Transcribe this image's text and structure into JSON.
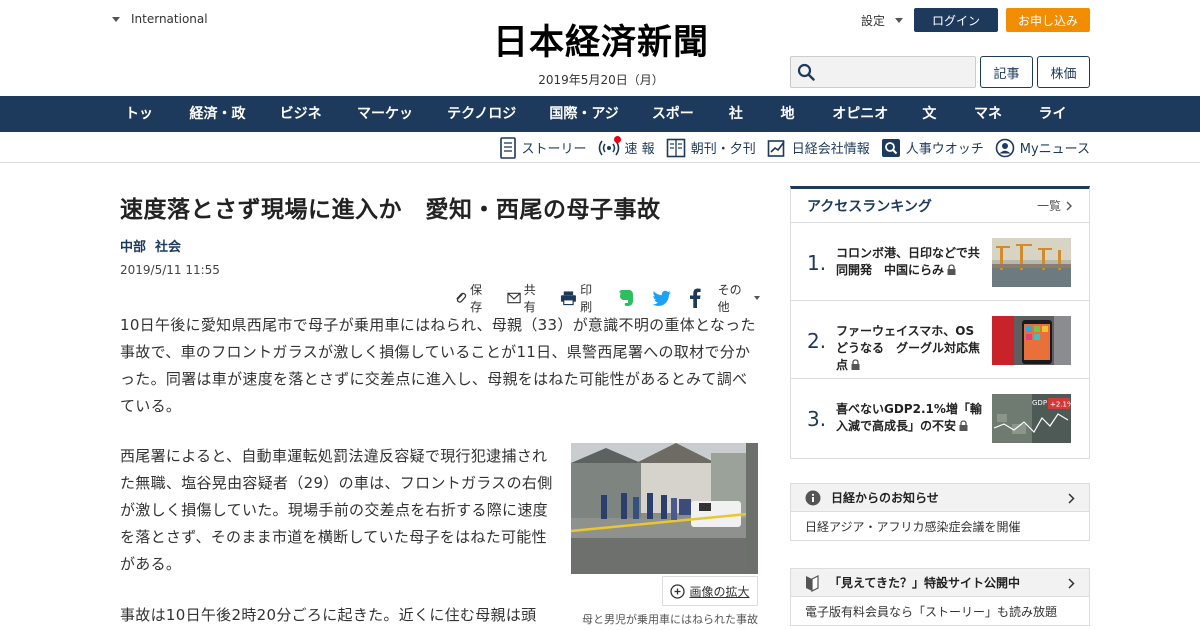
{
  "header": {
    "international_label": "International",
    "logo_text": "日本経済新聞",
    "date": "2019年5月20日（月）",
    "settings_label": "設定",
    "login_label": "ログイン",
    "apply_label": "お申し込み",
    "search_placeholder": "",
    "article_button": "記事",
    "stock_button": "株価"
  },
  "main_nav": [
    "トップ",
    "経済・政治",
    "ビジネス",
    "マーケット",
    "テクノロジー",
    "国際・アジア",
    "スポーツ",
    "社会",
    "地域",
    "オピニオン",
    "文化",
    "マネー",
    "ライフ"
  ],
  "sub_nav": {
    "story": "ストーリー",
    "breaking": "速 報",
    "paper": "朝刊・夕刊",
    "company": "日経会社情報",
    "personnel": "人事ウオッチ",
    "mynews": "Myニュース"
  },
  "article": {
    "headline": "速度落とさず現場に進入か　愛知・西尾の母子事故",
    "categories": [
      "中部",
      "社会"
    ],
    "published": "2019/5/11 11:55",
    "tools": {
      "save": "保存",
      "share": "共有",
      "print": "印刷",
      "more": "その他"
    },
    "paragraphs": [
      "10日午後に愛知県西尾市で母子が乗用車にはねられ、母親（33）が意識不明の重体となった事故で、車のフロントガラスが激しく損傷していることが11日、県警西尾署への取材で分かった。同署は車が速度を落とさずに交差点に進入し、母親をはねた可能性があるとみて調べている。",
      "西尾署によると、自動車運転処罰法違反容疑で現行犯逮捕された無職、塩谷晃由容疑者（29）の車は、フロントガラスの右側が激しく損傷していた。現場手前の交差点を右折する際に速度を落とさず、そのまま市道を横断していた母子をはねた可能性がある。",
      "事故は10日午後2時20分ごろに起きた。近くに住む母親は頭"
    ],
    "zoom_label": "画像の拡大",
    "caption": "母と男児が乗用車にはねられた事故"
  },
  "ranking": {
    "title": "アクセスランキング",
    "all_label": "一覧",
    "items": [
      {
        "rank": "1.",
        "title": "コロンボ港、日印などで共同開発　中国にらみ"
      },
      {
        "rank": "2.",
        "title": "ファーウェイスマホ、OSどうなる　グーグル対応焦点"
      },
      {
        "rank": "3.",
        "title": "喜べないGDP2.1%増「輸入減で高成長」の不安"
      }
    ],
    "thumb3_label": "GDP",
    "thumb3_value": "+2.1%"
  },
  "notices": [
    {
      "title": "日経からのお知らせ",
      "body": "日経アジア・アフリカ感染症会議を開催"
    },
    {
      "title": "「見えてきた？」特設サイト公開中",
      "body": "電子版有料会員なら「ストーリー」も読み放題"
    }
  ],
  "colors": {
    "navy": "#1d3a5c",
    "orange": "#f28c00",
    "breaking_dot": "#e60012"
  }
}
